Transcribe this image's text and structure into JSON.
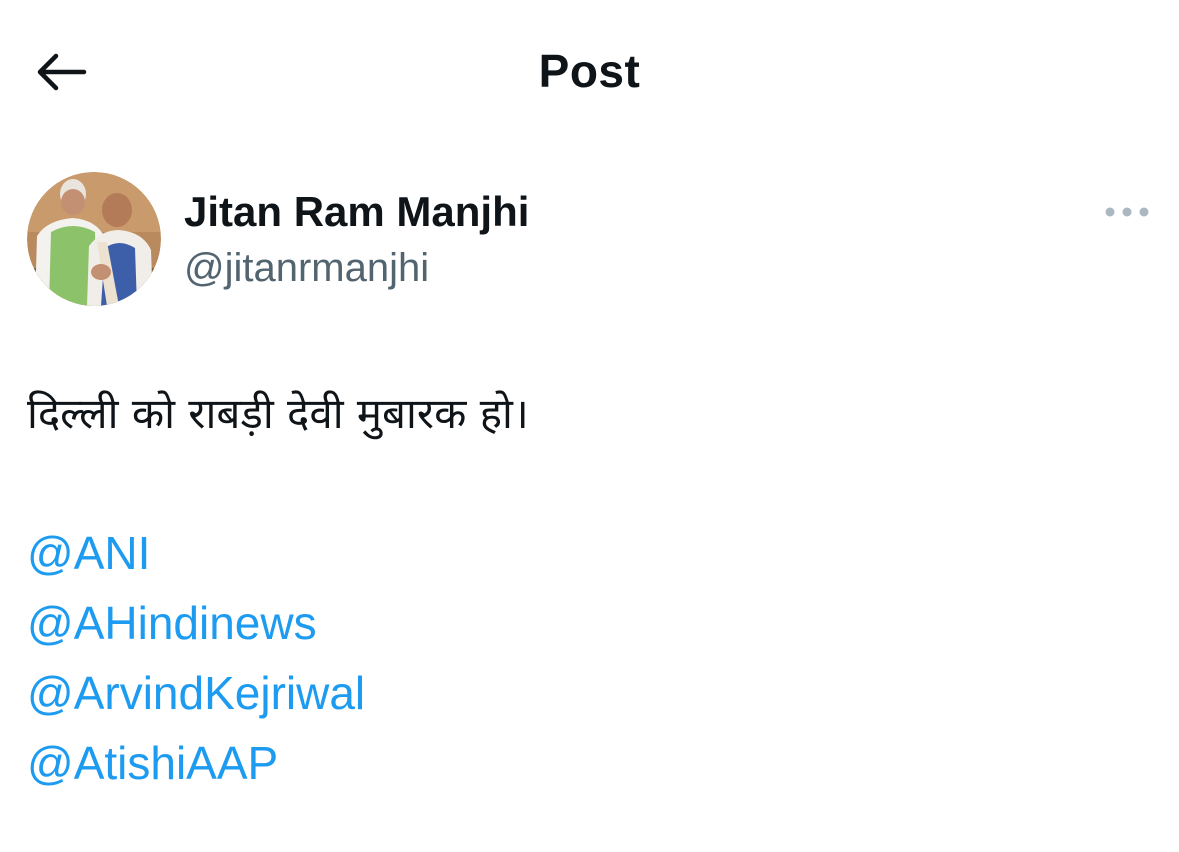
{
  "header": {
    "title": "Post",
    "back_icon": "arrow-left-icon"
  },
  "author": {
    "display_name": "Jitan Ram Manjhi",
    "handle": "@jitanrmanjhi",
    "more_icon": "more-horizontal-icon"
  },
  "post": {
    "text": "दिल्ली को राबड़ी देवी मुबारक हो।",
    "mentions": [
      "@ANI",
      "@AHindinews",
      "@ArvindKejriwal",
      "@AtishiAAP"
    ]
  },
  "colors": {
    "text_primary": "#0f1419",
    "text_secondary": "#536471",
    "link": "#1d9bf0",
    "icon_muted": "#aab8c2"
  }
}
